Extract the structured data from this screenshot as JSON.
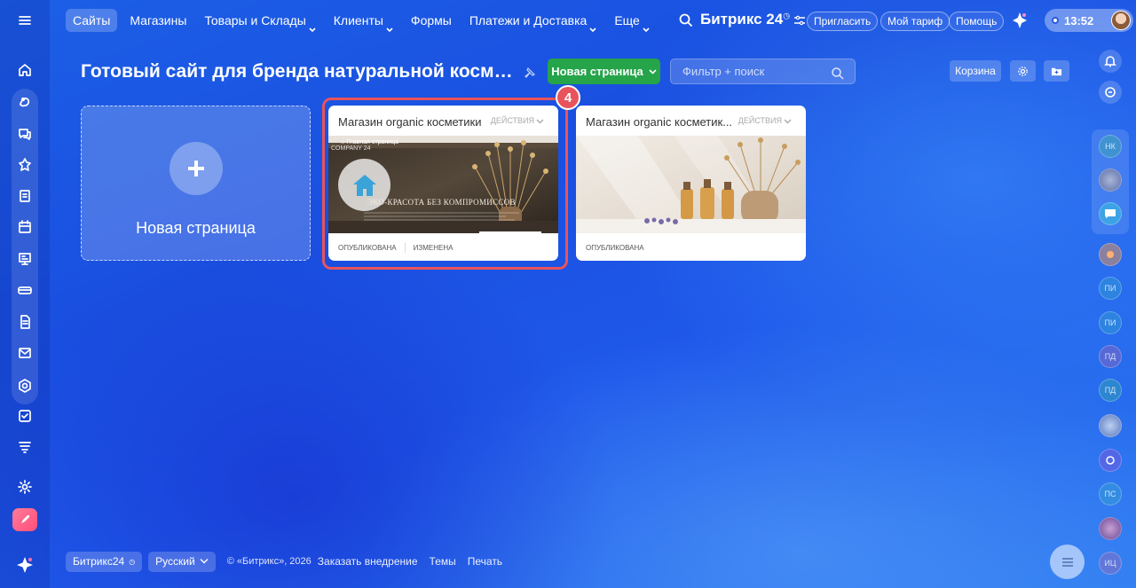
{
  "topnav": {
    "items": [
      {
        "label": "Сайты",
        "active": true,
        "dropdown": false
      },
      {
        "label": "Магазины",
        "active": false,
        "dropdown": false
      },
      {
        "label": "Товары и Склады",
        "active": false,
        "dropdown": true
      },
      {
        "label": "Клиенты",
        "active": false,
        "dropdown": true
      },
      {
        "label": "Формы",
        "active": false,
        "dropdown": false
      },
      {
        "label": "Платежи и Доставка",
        "active": false,
        "dropdown": true
      },
      {
        "label": "Еще",
        "active": false,
        "dropdown": true
      }
    ],
    "brand": "Битрикс 24",
    "invite_label": "Пригласить",
    "tariff_label": "Мой тариф",
    "help_label": "Помощь",
    "time": "13:52"
  },
  "page": {
    "title": "Готовый сайт для бренда натуральной космети...",
    "new_page_button": "Новая страница",
    "filter_placeholder": "Фильтр + поиск",
    "trash_label": "Корзина"
  },
  "new_card": {
    "label": "Новая страница"
  },
  "cards": [
    {
      "title": "Магазин organic косметики",
      "actions_label": "ДЕЙСТВИЯ",
      "status_published": "ОПУБЛИКОВАНА",
      "status_changed": "ИЗМЕНЕНА",
      "preview": {
        "company": "COMPANY 24",
        "home_label": "Главная страница",
        "headline": "ЭКО-КРАСОТА БЕЗ КОМПРОМИССОВ"
      }
    },
    {
      "title": "Магазин organic косметик...",
      "actions_label": "ДЕЙСТВИЯ",
      "status_published": "ОПУБЛИКОВАНА"
    }
  ],
  "step_badge": "4",
  "right_bar": {
    "avatars": [
      "НК",
      "ПИ",
      "ПИ",
      "ПД",
      "ПД",
      "ПС",
      "ИЦ"
    ]
  },
  "footer": {
    "brand_chip": "Битрикс24",
    "language": "Русский",
    "copyright": "© «Битрикс», 2026",
    "order_link": "Заказать внедрение",
    "themes_link": "Темы",
    "print_link": "Печать"
  },
  "colors": {
    "accent_green": "#25a44a",
    "highlight_red": "#e8545c",
    "background_blue": "#1c5fe6"
  }
}
